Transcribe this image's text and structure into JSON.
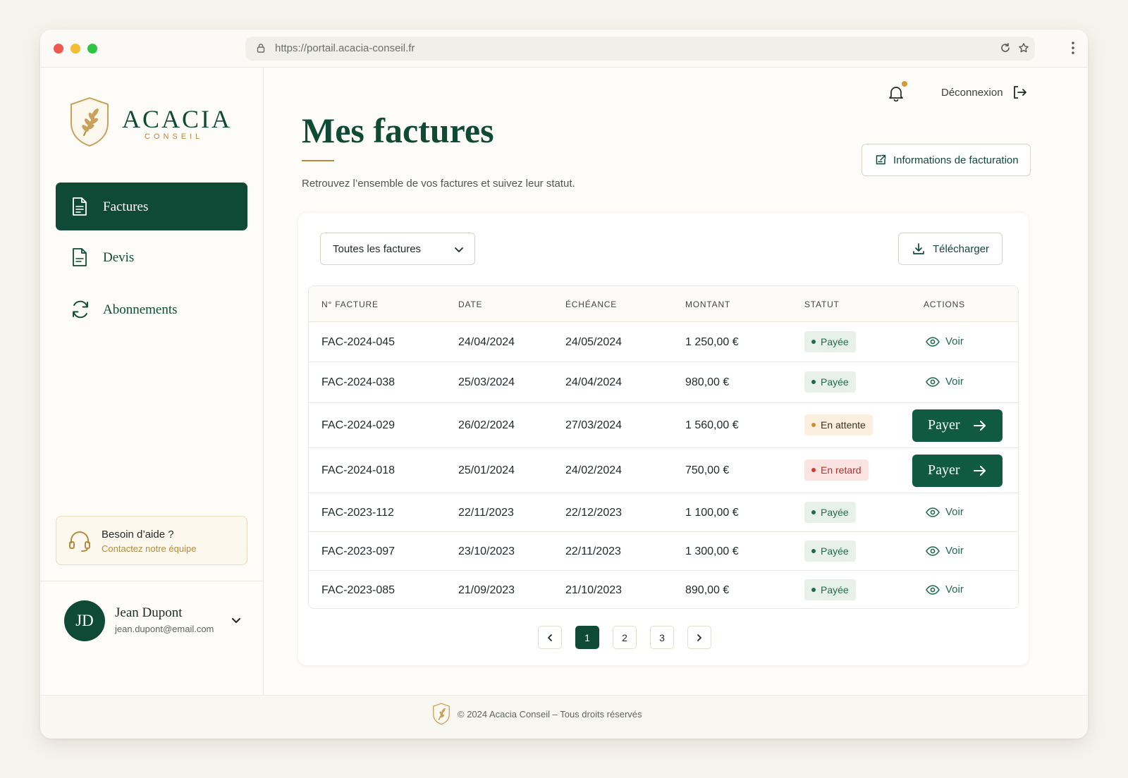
{
  "browser": {
    "url": "https://portail.acacia-conseil.fr"
  },
  "brand": {
    "name": "ACACIA",
    "tagline": "CONSEIL",
    "primary_color": "#0f4a36",
    "accent_color": "#b58a3c"
  },
  "sidebar": {
    "items": [
      {
        "label": "Factures",
        "icon": "document-icon",
        "active": true
      },
      {
        "label": "Devis",
        "icon": "document-icon",
        "active": false
      },
      {
        "label": "Abonnements",
        "icon": "refresh-icon",
        "active": false
      }
    ],
    "help": {
      "title": "Besoin d’aide ?",
      "link": "Contactez notre équipe"
    },
    "user": {
      "initials": "JD",
      "name": "Jean Dupont",
      "email": "jean.dupont@email.com"
    }
  },
  "header": {
    "logout_label": "Déconnexion"
  },
  "page": {
    "title": "Mes factures",
    "subtitle": "Retrouvez l’ensemble de vos factures et suivez leur statut.",
    "billing_button": "Informations de facturation"
  },
  "toolbar": {
    "filter_value": "Toutes les factures",
    "download_label": "Télécharger"
  },
  "table": {
    "columns": [
      "N° FACTURE",
      "DATE",
      "ÉCHÉANCE",
      "MONTANT",
      "STATUT",
      "ACTIONS"
    ],
    "rows": [
      {
        "id": "FAC-2024-045",
        "date": "24/04/2024",
        "due": "24/05/2024",
        "amount": "1 250,00 €",
        "status": "Payée",
        "status_kind": "paid",
        "action": "Voir"
      },
      {
        "id": "FAC-2024-038",
        "date": "25/03/2024",
        "due": "24/04/2024",
        "amount": "980,00 €",
        "status": "Payée",
        "status_kind": "paid",
        "action": "Voir"
      },
      {
        "id": "FAC-2024-029",
        "date": "26/02/2024",
        "due": "27/03/2024",
        "amount": "1 560,00 €",
        "status": "En attente",
        "status_kind": "pending",
        "action": "Payer"
      },
      {
        "id": "FAC-2024-018",
        "date": "25/01/2024",
        "due": "24/02/2024",
        "amount": "750,00 €",
        "status": "En retard",
        "status_kind": "late",
        "action": "Payer"
      },
      {
        "id": "FAC-2023-112",
        "date": "22/11/2023",
        "due": "22/12/2023",
        "amount": "1 100,00 €",
        "status": "Payée",
        "status_kind": "paid",
        "action": "Voir"
      },
      {
        "id": "FAC-2023-097",
        "date": "23/10/2023",
        "due": "22/11/2023",
        "amount": "1 300,00 €",
        "status": "Payée",
        "status_kind": "paid",
        "action": "Voir"
      },
      {
        "id": "FAC-2023-085",
        "date": "21/09/2023",
        "due": "21/10/2023",
        "amount": "890,00 €",
        "status": "Payée",
        "status_kind": "paid",
        "action": "Voir"
      }
    ]
  },
  "pagination": {
    "pages": [
      "1",
      "2",
      "3"
    ],
    "current": "1"
  },
  "footer": {
    "text": "© 2024 Acacia Conseil – Tous droits réservés"
  }
}
